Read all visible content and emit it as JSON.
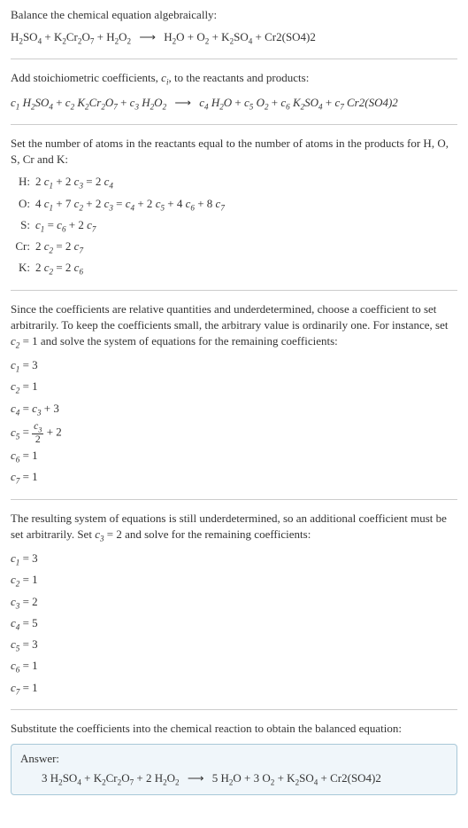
{
  "title": "Balance the chemical equation algebraically:",
  "unbalanced_eq_left": "H₂SO₄ + K₂Cr₂O₇ + H₂O₂",
  "unbalanced_eq_right": "H₂O + O₂ + K₂SO₄ + Cr2(SO4)2",
  "arrow": "⟶",
  "step1_text": "Add stoichiometric coefficients, cᵢ, to the reactants and products:",
  "stoich_eq_left_parts": {
    "c1": "c₁ H₂SO₄",
    "c2": "c₂ K₂Cr₂O₇",
    "c3": "c₃ H₂O₂"
  },
  "stoich_eq_right_parts": {
    "c4": "c₄ H₂O",
    "c5": "c₅ O₂",
    "c6": "c₆ K₂SO₄",
    "c7": "c₇ Cr2(SO4)2"
  },
  "step2_text": "Set the number of atoms in the reactants equal to the number of atoms in the products for H, O, S, Cr and K:",
  "atom_eqs": [
    {
      "label": "H:",
      "eq": "2 c₁ + 2 c₃ = 2 c₄"
    },
    {
      "label": "O:",
      "eq": "4 c₁ + 7 c₂ + 2 c₃ = c₄ + 2 c₅ + 4 c₆ + 8 c₇"
    },
    {
      "label": "S:",
      "eq": "c₁ = c₆ + 2 c₇"
    },
    {
      "label": "Cr:",
      "eq": "2 c₂ = 2 c₇"
    },
    {
      "label": "K:",
      "eq": "2 c₂ = 2 c₆"
    }
  ],
  "step3_text": "Since the coefficients are relative quantities and underdetermined, choose a coefficient to set arbitrarily. To keep the coefficients small, the arbitrary value is ordinarily one. For instance, set c₂ = 1 and solve the system of equations for the remaining coefficients:",
  "partial_solution": [
    {
      "text": "c₁ = 3",
      "frac": false
    },
    {
      "text": "c₂ = 1",
      "frac": false
    },
    {
      "text": "c₄ = c₃ + 3",
      "frac": false
    },
    {
      "text": "c₅ = ",
      "frac": true,
      "num": "c₃",
      "den": "2",
      "after": " + 2"
    },
    {
      "text": "c₆ = 1",
      "frac": false
    },
    {
      "text": "c₇ = 1",
      "frac": false
    }
  ],
  "step4_text": "The resulting system of equations is still underdetermined, so an additional coefficient must be set arbitrarily. Set c₃ = 2 and solve for the remaining coefficients:",
  "final_solution": [
    "c₁ = 3",
    "c₂ = 1",
    "c₃ = 2",
    "c₄ = 5",
    "c₅ = 3",
    "c₆ = 1",
    "c₇ = 1"
  ],
  "step5_text": "Substitute the coefficients into the chemical reaction to obtain the balanced equation:",
  "answer_label": "Answer:",
  "balanced_eq_left": "3 H₂SO₄ + K₂Cr₂O₇ + 2 H₂O₂",
  "balanced_eq_right": "5 H₂O + 3 O₂ + K₂SO₄ + Cr2(SO4)2"
}
